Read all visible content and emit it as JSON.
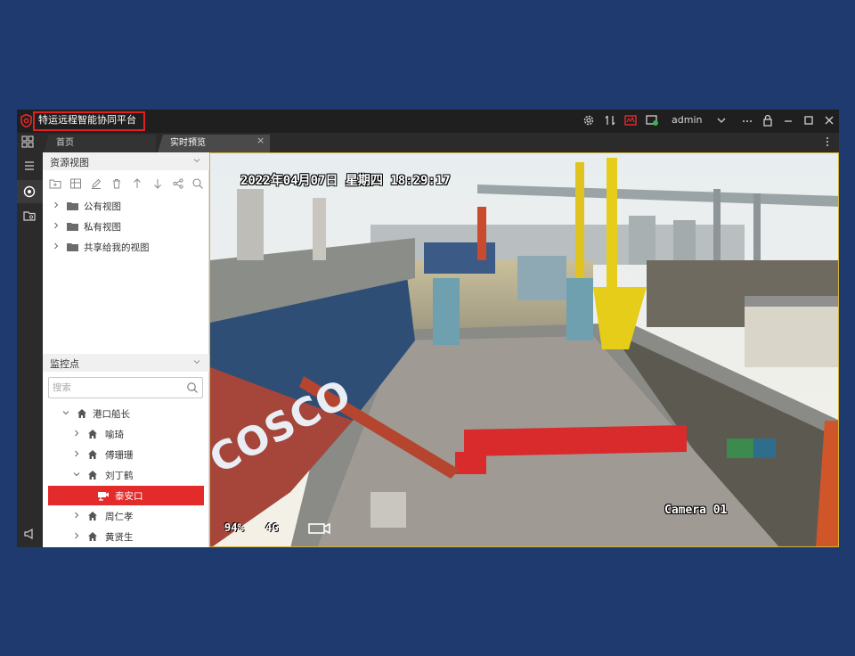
{
  "app": {
    "title": "特运远程智能协同平台",
    "user": "admin"
  },
  "tabs": [
    {
      "label": "首页"
    },
    {
      "label": "实时预览"
    }
  ],
  "tab_close": "×",
  "resource_panel": {
    "title": "资源视图",
    "items": [
      {
        "label": "公有视图"
      },
      {
        "label": "私有视图"
      },
      {
        "label": "共享给我的视图"
      }
    ]
  },
  "monitor_panel": {
    "title": "监控点",
    "search_placeholder": "搜索",
    "tree": [
      {
        "label": "港口船长"
      },
      {
        "label": "喻琦"
      },
      {
        "label": "傅珊珊"
      },
      {
        "label": "刘丁鹤"
      },
      {
        "label": "泰安口"
      },
      {
        "label": "周仁孝"
      },
      {
        "label": "黄贤生"
      }
    ]
  },
  "video": {
    "osd_datetime": "2022年04月07日 星期四 18:29:17",
    "osd_camera": "Camera 01",
    "osd_battery": "94%",
    "osd_network": "4G"
  },
  "colors": {
    "page_bg": "#1e3a6e",
    "accent_red": "#e42b2b",
    "titlebar": "#1f1f1f"
  }
}
